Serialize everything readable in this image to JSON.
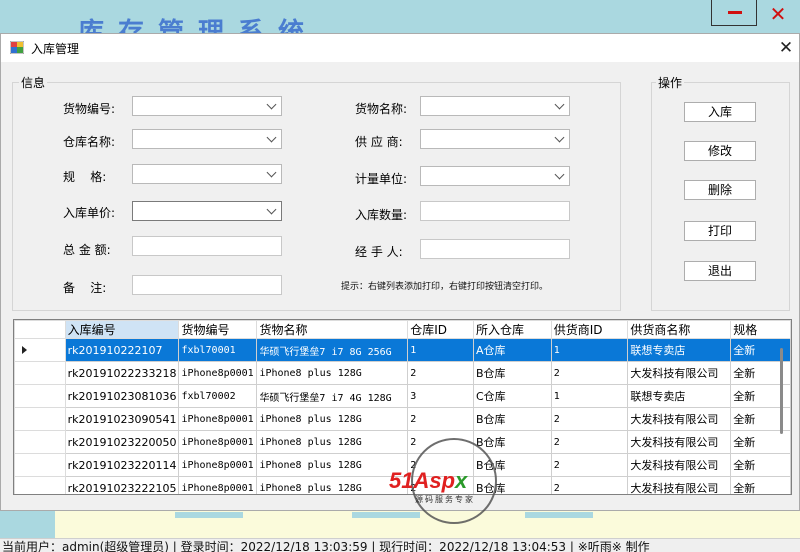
{
  "background_window": {
    "title": "库存管理系统",
    "close_glyph": "✕"
  },
  "dialog": {
    "title": "入库管理",
    "close_glyph": "✕"
  },
  "info_group": {
    "legend": "信息",
    "fields": {
      "goods_id_label": "货物编号:",
      "goods_name_label": "货物名称:",
      "warehouse_name_label": "仓库名称:",
      "supplier_label": "供 应 商:",
      "spec_label": "规    格:",
      "unit_label": "计量单位:",
      "unit_price_label": "入库单价:",
      "quantity_label": "入库数量:",
      "total_label": "总 金 额:",
      "handler_label": "经 手 人:",
      "remark_label": "备    注:"
    },
    "hint": "提示：右键列表添加打印，右键打印按钮清空打印。"
  },
  "ops_group": {
    "legend": "操作",
    "buttons": [
      "入库",
      "修改",
      "删除",
      "打印",
      "退出"
    ]
  },
  "grid": {
    "columns": [
      "入库编号",
      "货物编号",
      "货物名称",
      "仓库ID",
      "所入仓库",
      "供货商ID",
      "供货商名称",
      "规格"
    ],
    "rows": [
      [
        "rk201910222107",
        "fxbl70001",
        "华硕飞行堡垒7 i7 8G 256G",
        "1",
        "A仓库",
        "1",
        "联想专卖店",
        "全新"
      ],
      [
        "rk20191022233218",
        "iPhone8p0001",
        "iPhone8 plus 128G",
        "2",
        "B仓库",
        "2",
        "大发科技有限公司",
        "全新"
      ],
      [
        "rk20191023081036",
        "fxbl70002",
        "华硕飞行堡垒7 i7 4G 128G",
        "3",
        "C仓库",
        "1",
        "联想专卖店",
        "全新"
      ],
      [
        "rk20191023090541",
        "iPhone8p0001",
        "iPhone8 plus 128G",
        "2",
        "B仓库",
        "2",
        "大发科技有限公司",
        "全新"
      ],
      [
        "rk20191023220050",
        "iPhone8p0001",
        "iPhone8 plus 128G",
        "2",
        "B仓库",
        "2",
        "大发科技有限公司",
        "全新"
      ],
      [
        "rk20191023220114",
        "iPhone8p0001",
        "iPhone8 plus 128G",
        "2",
        "B仓库",
        "2",
        "大发科技有限公司",
        "全新"
      ],
      [
        "rk20191023222105",
        "iPhone8p0001",
        "iPhone8 plus 128G",
        "2",
        "B仓库",
        "2",
        "大发科技有限公司",
        "全新"
      ]
    ]
  },
  "watermark": {
    "brand_51": "51",
    "brand_asp": "Asp",
    "brand_x": "x",
    "subtitle": "源码服务专家"
  },
  "statusbar": {
    "text": "当前用户：admin(超级管理员) | 登录时间：2022/12/18 13:03:59 | 现行时间：2022/12/18 13:04:53 | ※听雨※ 制作"
  }
}
